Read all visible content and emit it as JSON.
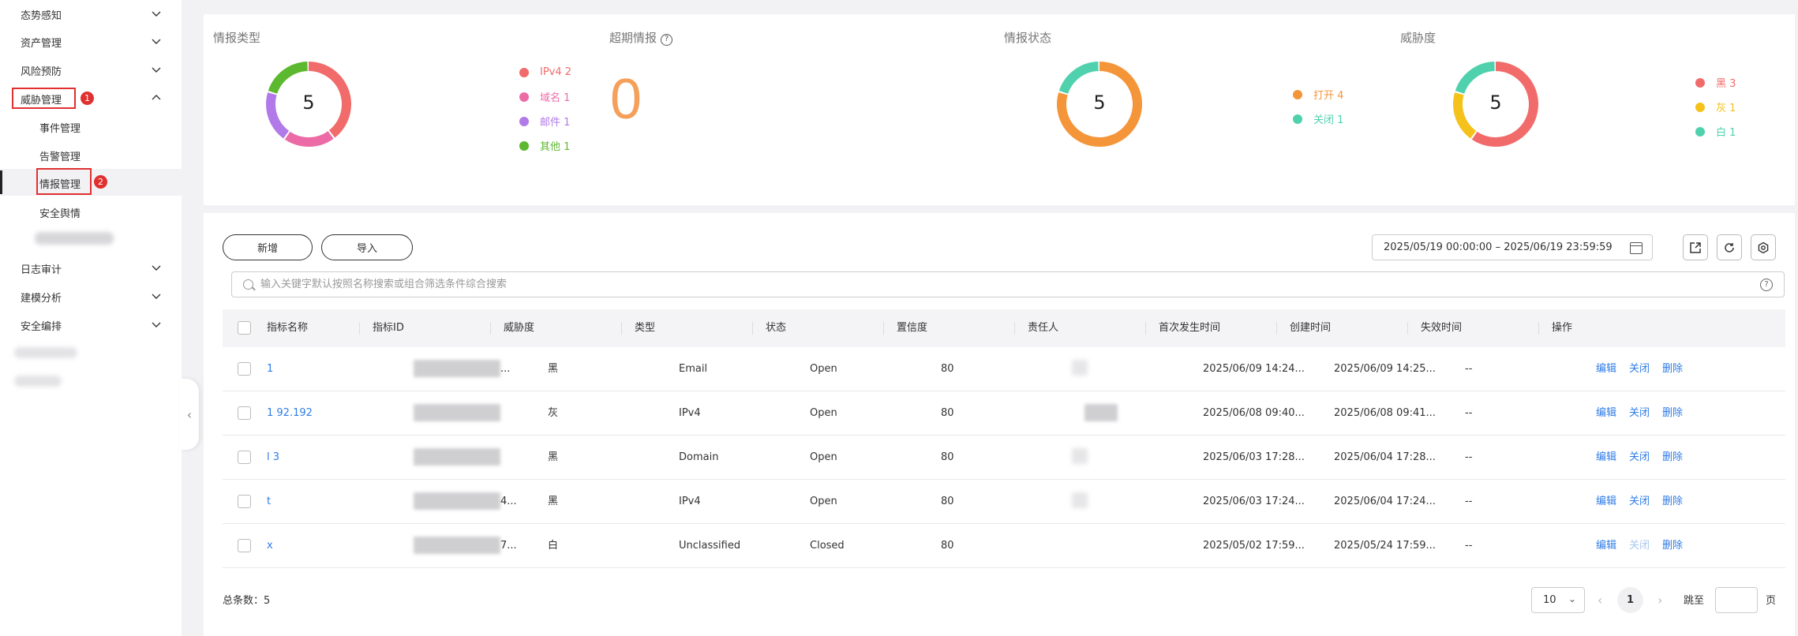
{
  "sidebar": {
    "items": [
      {
        "label": "态势感知",
        "expanded": false
      },
      {
        "label": "资产管理",
        "expanded": false
      },
      {
        "label": "风险预防",
        "expanded": false
      },
      {
        "label": "威胁管理",
        "expanded": true,
        "badge": "1"
      },
      {
        "label": "事件管理"
      },
      {
        "label": "告警管理"
      },
      {
        "label": "情报管理",
        "active": true,
        "badge": "2"
      },
      {
        "label": "安全舆情"
      },
      {
        "label": "日志审计",
        "expanded": false
      },
      {
        "label": "建模分析",
        "expanded": false
      },
      {
        "label": "安全编排",
        "expanded": false
      }
    ]
  },
  "stats": {
    "type": {
      "title": "情报类型",
      "total": "5",
      "legend": [
        {
          "label": "IPv4 2",
          "color": "#f26b6b",
          "value": 2
        },
        {
          "label": "域名 1",
          "color": "#ec6ba6",
          "value": 1
        },
        {
          "label": "邮件 1",
          "color": "#b27ae8",
          "value": 1
        },
        {
          "label": "其他 1",
          "color": "#5cb82e",
          "value": 1
        }
      ]
    },
    "expired": {
      "title": "超期情报",
      "help": "?",
      "value": "0",
      "color": "#f4a05a"
    },
    "status": {
      "title": "情报状态",
      "total": "5",
      "legend": [
        {
          "label": "打开 4",
          "color": "#f5953a",
          "value": 4
        },
        {
          "label": "关闭 1",
          "color": "#4fd1ad",
          "value": 1
        }
      ]
    },
    "threat": {
      "title": "威胁度",
      "total": "5",
      "legend": [
        {
          "label": "黑 3",
          "color": "#f26b6b",
          "value": 3
        },
        {
          "label": "灰 1",
          "color": "#f4c21a",
          "value": 1
        },
        {
          "label": "白 1",
          "color": "#4fd1ad",
          "value": 1
        }
      ]
    }
  },
  "toolbar": {
    "add_label": "新增",
    "import_label": "导入",
    "date_range": "2025/05/19 00:00:00 – 2025/06/19 23:59:59",
    "search_placeholder": "输入关键字默认按照名称搜索或组合筛选条件综合搜索"
  },
  "table": {
    "columns": [
      "指标名称",
      "指标ID",
      "威胁度",
      "类型",
      "状态",
      "置信度",
      "责任人",
      "首次发生时间",
      "创建时间",
      "失效时间",
      "操作"
    ],
    "rows": [
      {
        "name": "1",
        "id_suffix": "...",
        "threat": "黑",
        "type": "Email",
        "status": "Open",
        "confidence": "80",
        "first_time": "2025/06/09 14:24...",
        "create_time": "2025/06/09 14:25...",
        "expire": "--",
        "close_enabled": true
      },
      {
        "name": "1 92.192",
        "id_suffix": "",
        "threat": "灰",
        "type": "IPv4",
        "status": "Open",
        "confidence": "80",
        "first_time": "2025/06/08 09:40...",
        "create_time": "2025/06/08 09:41...",
        "expire": "--",
        "close_enabled": true
      },
      {
        "name": "l 3",
        "id_suffix": "",
        "threat": "黑",
        "type": "Domain",
        "status": "Open",
        "confidence": "80",
        "first_time": "2025/06/03 17:28...",
        "create_time": "2025/06/04 17:28...",
        "expire": "--",
        "close_enabled": true
      },
      {
        "name": "t",
        "id_suffix": "4...",
        "threat": "黑",
        "type": "IPv4",
        "status": "Open",
        "confidence": "80",
        "first_time": "2025/06/03 17:24...",
        "create_time": "2025/06/04 17:24...",
        "expire": "--",
        "close_enabled": true
      },
      {
        "name": "x",
        "id_suffix": "7...",
        "threat": "白",
        "type": "Unclassified",
        "status": "Closed",
        "confidence": "80",
        "first_time": "2025/05/02 17:59...",
        "create_time": "2025/05/24 17:59...",
        "expire": "--",
        "close_enabled": false
      }
    ],
    "actions": {
      "edit": "编辑",
      "close": "关闭",
      "delete": "删除"
    }
  },
  "pagination": {
    "total_label": "总条数：5",
    "page_size": "10",
    "current_page": "1",
    "jump_label": "跳至",
    "page_unit": "页"
  }
}
